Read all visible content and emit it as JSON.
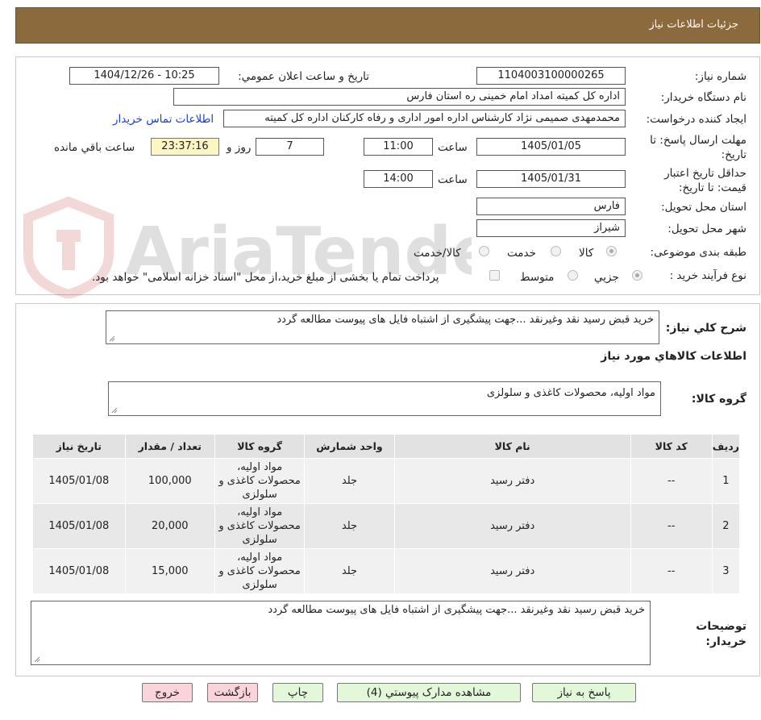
{
  "header": {
    "title": "جزئیات اطلاعات نیاز"
  },
  "form": {
    "need_number_label": "شماره نیاز:",
    "need_number": "1104003100000265",
    "announce_label": "تاریخ و ساعت اعلان عمومي:",
    "announce_value": "1404/12/26 - 10:25",
    "buyer_org_label": "نام دستگاه خریدار:",
    "buyer_org": "اداره کل کمیته امداد امام خمینی  ره  استان فارس",
    "requester_label": "ایجاد کننده درخواست:",
    "requester": "محمدمهدی صمیمی نژاد کارشناس اداره امور اداری و رفاه کارکنان اداره کل کمیته",
    "contact_link": "اطلاعات تماس خریدار",
    "deadline_label": "مهلت ارسال پاسخ: تا تاریخ:",
    "deadline_date": "1405/01/05",
    "time_label": "ساعت",
    "deadline_time": "11:00",
    "days_value": "7",
    "days_label": "روز و",
    "remaining_time": "23:37:16",
    "remaining_label": "ساعت باقي مانده",
    "price_validity_label": "حداقل تاریخ اعتبار قیمت: تا تاریخ:",
    "price_validity_date": "1405/01/31",
    "price_validity_time": "14:00",
    "province_label": "استان محل تحویل:",
    "province": "فارس",
    "city_label": "شهر محل تحویل:",
    "city": "شیراز",
    "category_label": "طبقه بندی موضوعی:",
    "category_options": [
      "کالا",
      "خدمت",
      "کالا/خدمت"
    ],
    "process_label": "نوع فرآیند خرید :",
    "process_options": [
      "جزیي",
      "متوسط"
    ],
    "payment_note": "پرداخت تمام یا بخشی از مبلغ خرید،از محل \"اسناد خزانه اسلامی\" خواهد بود."
  },
  "summary": {
    "label": "شرح کلي نیاز:",
    "text": "خرید قبض رسید نقد وغیرنقد ...جهت پیشگیری از اشتباه فایل های پیوست مطالعه گردد",
    "goods_info_title": "اطلاعات کالاهاي مورد نیاز",
    "goods_group_label": "گروه کالا:",
    "goods_group": "مواد اولیه، محصولات کاغذی و سلولزی"
  },
  "table": {
    "headers": [
      "ردیف",
      "کد کالا",
      "نام کالا",
      "واحد شمارش",
      "گروه کالا",
      "تعداد / مقدار",
      "تاریخ نیاز"
    ],
    "rows": [
      {
        "row": "1",
        "code": "--",
        "name": "دفتر رسید",
        "unit": "جلد",
        "group": "مواد اولیه، محصولات کاغذی و سلولزی",
        "qty": "100,000",
        "date": "1405/01/08"
      },
      {
        "row": "2",
        "code": "--",
        "name": "دفتر رسید",
        "unit": "جلد",
        "group": "مواد اولیه، محصولات کاغذی و سلولزی",
        "qty": "20,000",
        "date": "1405/01/08"
      },
      {
        "row": "3",
        "code": "--",
        "name": "دفتر رسید",
        "unit": "جلد",
        "group": "مواد اولیه، محصولات کاغذی و سلولزی",
        "qty": "15,000",
        "date": "1405/01/08"
      }
    ]
  },
  "buyer_notes": {
    "label": "توضیحات خریدار:",
    "text": "خرید قبض رسید نقد وغیرنقد ...جهت پیشگیری از اشتباه فایل های پیوست مطالعه گردد"
  },
  "buttons": {
    "reply": "پاسخ به نیاز",
    "attachments": "مشاهده مدارک پیوستي (4)",
    "print": "چاپ",
    "back": "بازگشت",
    "exit": "خروج"
  },
  "watermark": {
    "text": "AriaTender.neT"
  },
  "colors": {
    "header": "#8b6a3e",
    "link": "#1a3fcc",
    "green_button": "#e3f7d9",
    "pink_button": "#f9d5d9",
    "yellow_field": "#fbf6c3"
  }
}
